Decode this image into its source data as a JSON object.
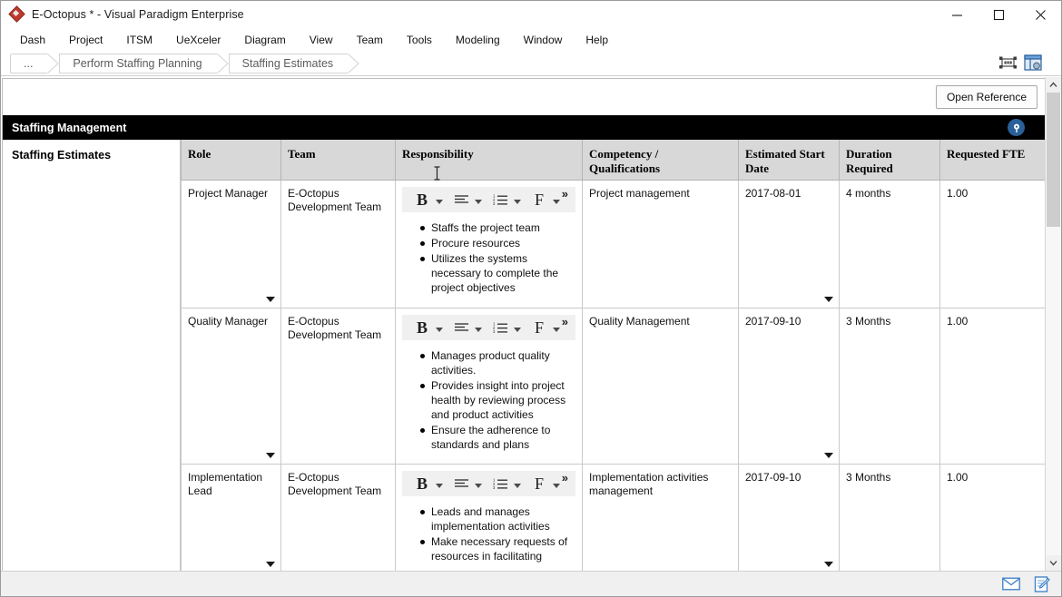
{
  "window": {
    "title": "E-Octopus * - Visual Paradigm Enterprise",
    "logo_icon": "visual-paradigm-diamond-logo",
    "controls": {
      "minimize": "minimize-icon",
      "maximize": "maximize-icon",
      "close": "close-icon"
    }
  },
  "menu": {
    "items": [
      {
        "label": "Dash"
      },
      {
        "label": "Project"
      },
      {
        "label": "ITSM"
      },
      {
        "label": "UeXceler"
      },
      {
        "label": "Diagram"
      },
      {
        "label": "View"
      },
      {
        "label": "Team"
      },
      {
        "label": "Tools"
      },
      {
        "label": "Modeling"
      },
      {
        "label": "Window"
      },
      {
        "label": "Help"
      }
    ]
  },
  "breadcrumb": {
    "items": [
      {
        "label": "..."
      },
      {
        "label": "Perform Staffing Planning"
      },
      {
        "label": "Staffing Estimates"
      }
    ],
    "icons": [
      {
        "name": "fit-selection-icon"
      },
      {
        "name": "show-panel-icon"
      }
    ]
  },
  "toolbar": {
    "open_reference_label": "Open Reference"
  },
  "section": {
    "title": "Staffing Management",
    "badge_icon": "pin-marker-icon"
  },
  "left_panel": {
    "title": "Staffing Estimates"
  },
  "table": {
    "columns": [
      "Role",
      "Team",
      "Responsibility",
      "Competency / Qualifications",
      "Estimated Start Date",
      "Duration Required",
      "Requested FTE"
    ],
    "rich_text_toolbar": {
      "bold_label": "B",
      "align_icon": "align-left-icon",
      "list_icon": "numbered-list-icon",
      "font_label": "F",
      "more_label": "»"
    },
    "rows": [
      {
        "role": "Project Manager",
        "team": "E-Octopus Development Team",
        "responsibility": [
          "Staffs the project team",
          "Procure resources",
          "Utilizes the systems necessary to complete the project objectives"
        ],
        "competency": "Project management",
        "start_date": "2017-08-01",
        "duration": "4 months",
        "fte": "1.00"
      },
      {
        "role": "Quality Manager",
        "team": "E-Octopus Development Team",
        "responsibility": [
          "Manages product quality activities.",
          "Provides insight into project health by reviewing process and product activities",
          "Ensure the adherence to standards and plans"
        ],
        "competency": "Quality Management",
        "start_date": "2017-09-10",
        "duration": "3 Months",
        "fte": "1.00"
      },
      {
        "role": "Implementation Lead",
        "team": "E-Octopus Development Team",
        "responsibility": [
          "Leads and manages implementation activities",
          "Make necessary requests of resources in facilitating"
        ],
        "competency": "Implementation activities management",
        "start_date": "2017-09-10",
        "duration": "3 Months",
        "fte": "1.00"
      }
    ]
  },
  "statusbar": {
    "icons": [
      {
        "name": "mail-envelope-icon"
      },
      {
        "name": "note-edit-icon"
      }
    ]
  },
  "colors": {
    "section_header_bg": "#000000",
    "badge_blue": "#2a6099",
    "header_bg": "#d8d8d8",
    "accent_icon_blue": "#3a7dc9"
  }
}
